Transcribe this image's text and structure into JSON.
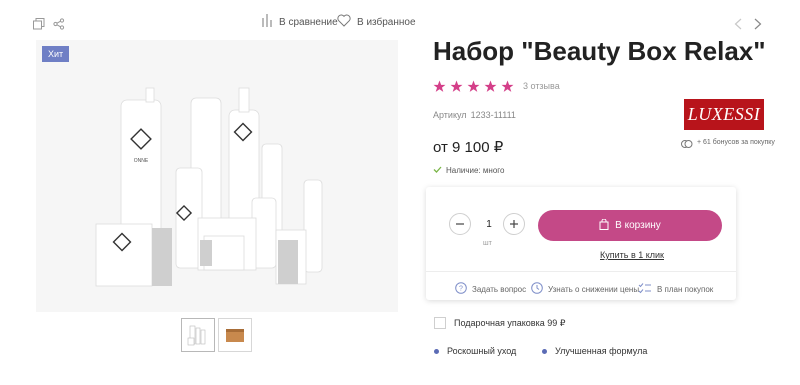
{
  "toolbar": {
    "compare_label": "В сравнение",
    "favorite_label": "В избранное"
  },
  "product": {
    "badge": "Хит",
    "title": "Набор \"Beauty Box Relax\"",
    "rating": 5,
    "reviews_label": "3 отзыва",
    "sku_label": "Артикул",
    "sku_value": "1233-11111",
    "brand_logo_text": "LUXESSI",
    "price": "от 9 100 ₽",
    "bonus_text": "+ 61 бонусов за покупку",
    "stock_text": "Наличие: много"
  },
  "buy_box": {
    "quantity": "1",
    "unit": "шт",
    "cart_label": "В корзину",
    "one_click_label": "Купить в 1 клик",
    "actions": [
      {
        "label": "Задать вопрос",
        "icon": "question-icon"
      },
      {
        "label": "Узнать о снижении цены",
        "icon": "clock-icon"
      },
      {
        "label": "В план покупок",
        "icon": "checklist-icon"
      }
    ]
  },
  "options": {
    "gift_wrap_label": "Подарочная упаковка 99 ₽",
    "features": [
      "Роскошный уход",
      "Улучшенная формула"
    ]
  },
  "product_image": {
    "bottle_brand": "ONNE"
  },
  "colors": {
    "accent": "#c44987",
    "star": "#d43f89",
    "badge": "#6f7fc5",
    "logo_bg": "#b8141b",
    "dot": "#5b6bb5"
  }
}
